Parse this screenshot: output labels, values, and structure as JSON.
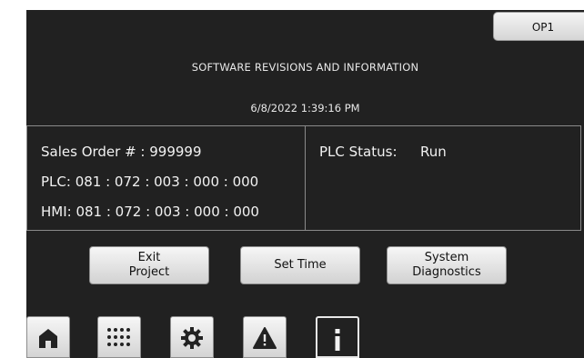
{
  "header": {
    "op_label": "OP1",
    "title": "SOFTWARE REVISIONS AND INFORMATION",
    "datetime": "6/8/2022 1:39:16 PM"
  },
  "info": {
    "sales_order": "Sales Order # : 999999",
    "plc": "PLC:  081 : 072 : 003 : 000 : 000",
    "hmi": "HMI:  081 : 072 : 003 : 000 : 000",
    "plc_status_label": "PLC Status:",
    "plc_status_value": "Run"
  },
  "buttons": {
    "exit_line1": "Exit",
    "exit_line2": "Project",
    "set_time": "Set Time",
    "diag_line1": "System",
    "diag_line2": "Diagnostics"
  },
  "nav": [
    {
      "icon": "home-icon"
    },
    {
      "icon": "keypad-icon"
    },
    {
      "icon": "gear-icon"
    },
    {
      "icon": "warning-icon"
    },
    {
      "icon": "info-icon"
    }
  ],
  "colors": {
    "background": "#212121",
    "panel_border": "#8a8a8a",
    "text": "#f2f2f2"
  }
}
